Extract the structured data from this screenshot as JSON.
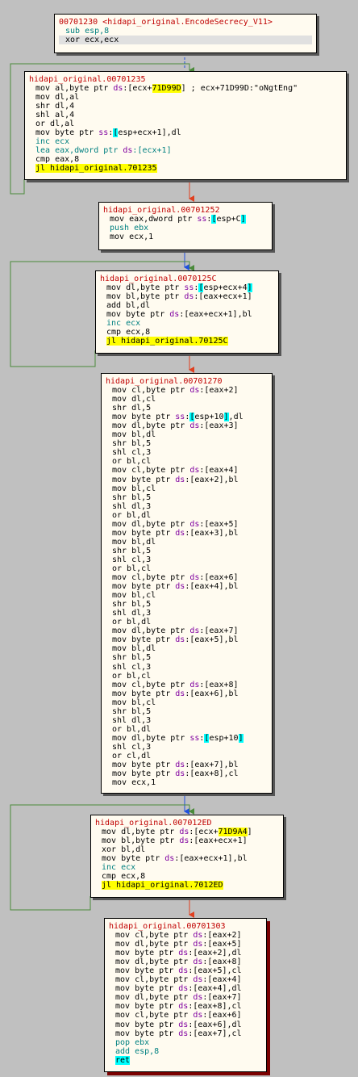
{
  "colors": {
    "edge_green": "#4a8a3a",
    "edge_red": "#e04020",
    "edge_blue": "#2050e0",
    "block_bg": "#fffbf0"
  },
  "blocks": [
    {
      "lines": [
        "00701230 <hidapi_original.EncodeSecrecy_V11>",
        "sub esp,8",
        "xor ecx,ecx"
      ]
    },
    {
      "lines": [
        "hidapi_original.00701235",
        "mov al,byte ptr ds:[ecx+71D99D] ; ecx+71D99D:\"oNgtEng\"",
        "mov dl,al",
        "shr dl,4",
        "shl al,4",
        "or dl,al",
        "mov byte ptr ss:[esp+ecx+1],dl",
        "inc ecx",
        "lea eax,dword ptr ds:[ecx+1]",
        "cmp eax,8",
        "jl hidapi_original.701235"
      ]
    },
    {
      "lines": [
        "hidapi_original.00701252",
        "mov eax,dword ptr ss:[esp+C]",
        "push ebx",
        "mov ecx,1"
      ]
    },
    {
      "lines": [
        "hidapi_original.0070125C",
        "mov dl,byte ptr ss:[esp+ecx+4]",
        "mov bl,byte ptr ds:[eax+ecx+1]",
        "add bl,dl",
        "mov byte ptr ds:[eax+ecx+1],bl",
        "inc ecx",
        "cmp ecx,8",
        "jl hidapi_original.70125C"
      ]
    },
    {
      "lines": [
        "hidapi_original.00701270",
        "mov cl,byte ptr ds:[eax+2]",
        "mov dl,cl",
        "shr dl,5",
        "mov byte ptr ss:[esp+10],dl",
        "mov dl,byte ptr ds:[eax+3]",
        "mov bl,dl",
        "shr bl,5",
        "shl cl,3",
        "or bl,cl",
        "mov cl,byte ptr ds:[eax+4]",
        "mov byte ptr ds:[eax+2],bl",
        "mov bl,cl",
        "shr bl,5",
        "shl dl,3",
        "or bl,dl",
        "mov dl,byte ptr ds:[eax+5]",
        "mov byte ptr ds:[eax+3],bl",
        "mov bl,dl",
        "shr bl,5",
        "shl cl,3",
        "or bl,cl",
        "mov cl,byte ptr ds:[eax+6]",
        "mov byte ptr ds:[eax+4],bl",
        "mov bl,cl",
        "shr bl,5",
        "shl dl,3",
        "or bl,dl",
        "mov dl,byte ptr ds:[eax+7]",
        "mov byte ptr ds:[eax+5],bl",
        "mov bl,dl",
        "shr bl,5",
        "shl cl,3",
        "or bl,cl",
        "mov cl,byte ptr ds:[eax+8]",
        "mov byte ptr ds:[eax+6],bl",
        "mov bl,cl",
        "shr bl,5",
        "shl dl,3",
        "or bl,dl",
        "mov dl,byte ptr ss:[esp+10]",
        "shl cl,3",
        "or cl,dl",
        "mov byte ptr ds:[eax+7],bl",
        "mov byte ptr ds:[eax+8],cl",
        "mov ecx,1"
      ]
    },
    {
      "lines": [
        "hidapi_original.007012ED",
        "mov dl,byte ptr ds:[ecx+71D9A4]",
        "mov bl,byte ptr ds:[eax+ecx+1]",
        "xor bl,dl",
        "mov byte ptr ds:[eax+ecx+1],bl",
        "inc ecx",
        "cmp ecx,8",
        "jl hidapi_original.7012ED"
      ]
    },
    {
      "lines": [
        "hidapi_original.00701303",
        "mov cl,byte ptr ds:[eax+2]",
        "mov dl,byte ptr ds:[eax+5]",
        "mov byte ptr ds:[eax+2],dl",
        "mov dl,byte ptr ds:[eax+8]",
        "mov byte ptr ds:[eax+5],cl",
        "mov cl,byte ptr ds:[eax+4]",
        "mov byte ptr ds:[eax+4],dl",
        "mov dl,byte ptr ds:[eax+7]",
        "mov byte ptr ds:[eax+8],cl",
        "mov cl,byte ptr ds:[eax+6]",
        "mov byte ptr ds:[eax+6],dl",
        "mov byte ptr ds:[eax+7],cl",
        "pop ebx",
        "add esp,8",
        "ret"
      ]
    }
  ]
}
